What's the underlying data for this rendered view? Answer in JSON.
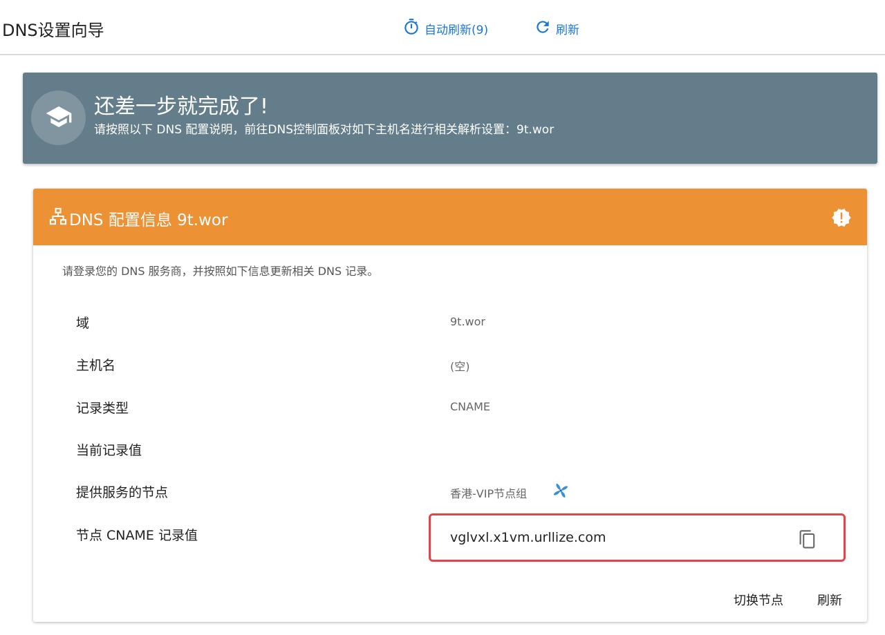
{
  "header": {
    "title": "DNS设置向导",
    "auto_refresh_label": "自动刷新(9)",
    "refresh_label": "刷新",
    "accent_color": "#1976d2"
  },
  "banner": {
    "title": "还差一步就完成了!",
    "subtitle": "请按照以下 DNS 配置说明，前往DNS控制面板对如下主机名进行相关解析设置：9t.wor",
    "icon": "graduation-cap-icon",
    "background_color": "#647d8a"
  },
  "card": {
    "title": "DNS 配置信息 9t.wor",
    "header_icon": "network-sitemap-icon",
    "alert_icon": "alert-decagram-icon",
    "header_color": "#ec9134",
    "description": "请登录您的 DNS 服务商，并按照如下信息更新相关 DNS 记录。",
    "rows": [
      {
        "label": "域",
        "value": "9t.wor"
      },
      {
        "label": "主机名",
        "value": "(空)"
      },
      {
        "label": "记录类型",
        "value": "CNAME"
      },
      {
        "label": "当前记录值",
        "value": ""
      },
      {
        "label": "提供服务的节点",
        "value": "香港-VIP节点组",
        "icon": "pinwheel-icon"
      },
      {
        "label": "节点 CNAME 记录值",
        "value": "vglvxl.x1vm.urllize.com",
        "icon": "copy-icon"
      }
    ],
    "highlight_color": "#e0454d",
    "actions": {
      "switch_node_label": "切换节点",
      "refresh_label": "刷新"
    }
  }
}
